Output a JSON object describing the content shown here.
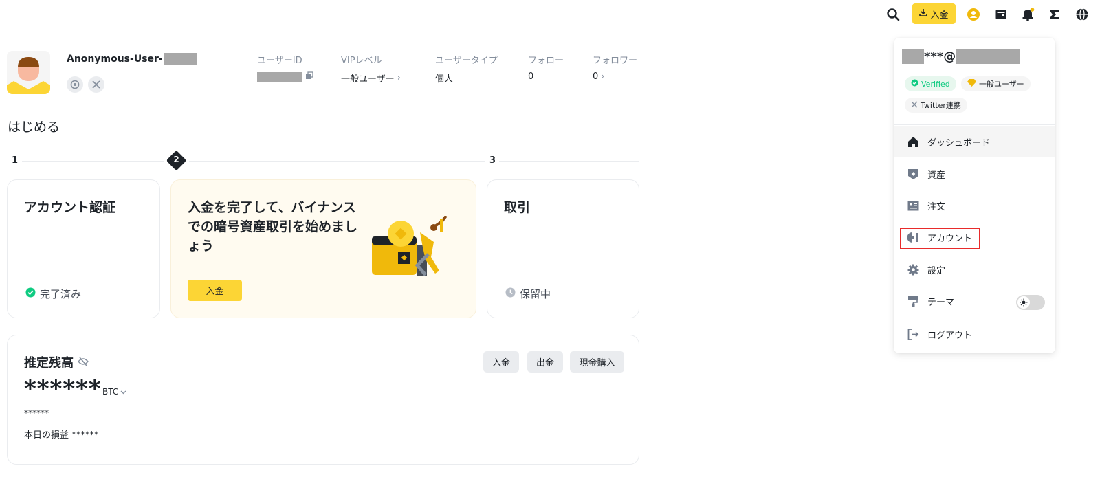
{
  "topnav": {
    "deposit_label": "入金",
    "icons": [
      "search-icon",
      "download-icon",
      "user-icon",
      "wallet-icon",
      "bell-icon",
      "transfer-icon",
      "globe-icon"
    ]
  },
  "profile": {
    "username": "Anonymous-User-",
    "stats": [
      {
        "label": "ユーザーID",
        "value": ""
      },
      {
        "label": "VIPレベル",
        "value": "一般ユーザー"
      },
      {
        "label": "ユーザータイプ",
        "value": "個人"
      },
      {
        "label": "フォロー",
        "value": "0"
      },
      {
        "label": "フォロワー",
        "value": "0"
      }
    ]
  },
  "getting_started": {
    "title": "はじめる",
    "steps": [
      "1",
      "2",
      "3"
    ],
    "cards": [
      {
        "title": "アカウント認証",
        "status": "完了済み"
      },
      {
        "title": "入金を完了して、バイナンスでの暗号資産取引を始めましょう",
        "button": "入金"
      },
      {
        "title": "取引",
        "status": "保留中"
      }
    ]
  },
  "balance": {
    "title": "推定残高",
    "amount": "******",
    "unit": "BTC",
    "sub": "******",
    "pnl": "本日の損益  ******",
    "buttons": [
      "入金",
      "出金",
      "現金購入"
    ]
  },
  "dropdown": {
    "email_mid": "***@",
    "badges": [
      "Verified",
      "一般ユーザー",
      "Twitter連携"
    ],
    "items": [
      "ダッシュボード",
      "資産",
      "注文",
      "アカウント",
      "設定",
      "テーマ",
      "ログアウト"
    ]
  },
  "colors": {
    "brand_yellow": "#fcd535",
    "success": "#0ecb81",
    "highlight": "#e82b2b"
  }
}
